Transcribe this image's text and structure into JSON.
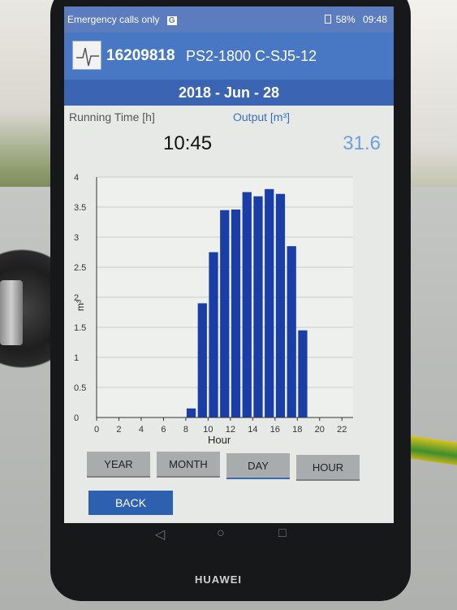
{
  "status_bar": {
    "left_text": "Emergency calls only",
    "sim_badge": "G",
    "battery": "58%",
    "time": "09:48"
  },
  "header": {
    "device_id": "16209818",
    "device_model": "PS2-1800 C-SJ5-12"
  },
  "date": "2018 - Jun - 28",
  "running_time": {
    "label": "Running Time [h]",
    "value": "10:45"
  },
  "output": {
    "label": "Output [m³]",
    "value": "31.6"
  },
  "chart_data": {
    "type": "bar",
    "xlabel": "Hour",
    "ylabel": "m³",
    "xlim": [
      0,
      23
    ],
    "ylim": [
      0,
      4
    ],
    "x_ticks": [
      0,
      2,
      4,
      6,
      8,
      10,
      12,
      14,
      16,
      18,
      20,
      22
    ],
    "y_ticks": [
      0,
      0.5,
      1,
      1.5,
      2,
      2.5,
      3,
      3.5,
      4
    ],
    "x": [
      8,
      9,
      10,
      11,
      12,
      13,
      14,
      15,
      16,
      17,
      18
    ],
    "values": [
      0.15,
      1.9,
      2.75,
      3.45,
      3.46,
      3.75,
      3.68,
      3.8,
      3.72,
      2.85,
      1.45
    ],
    "bar_color": "#1a3ea8"
  },
  "buttons": {
    "year": "YEAR",
    "month": "MONTH",
    "day": "DAY",
    "hour": "HOUR",
    "back": "BACK"
  },
  "nav": {
    "back_icon": "◁",
    "home_icon": "○",
    "recent_icon": "□"
  },
  "brand": "HUAWEI"
}
